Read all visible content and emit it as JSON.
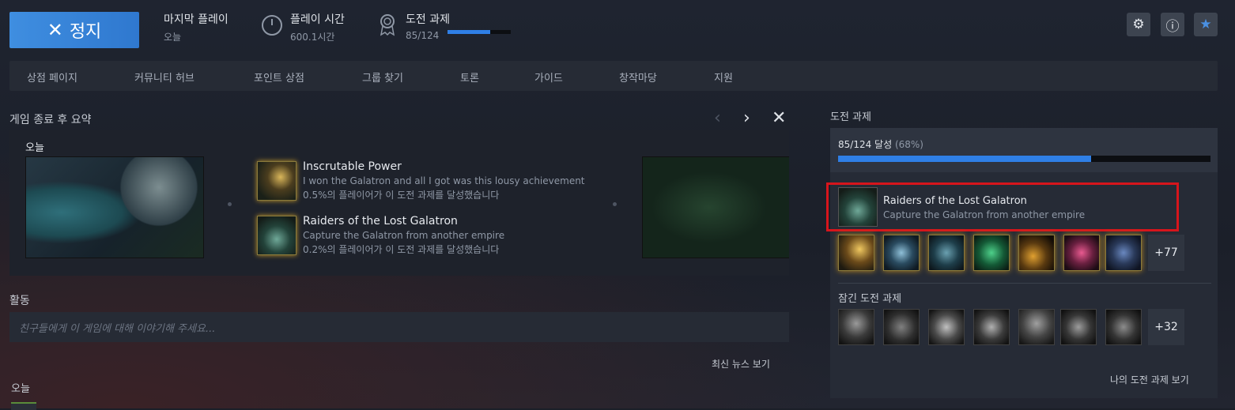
{
  "header": {
    "stop_label": "정지",
    "last_played_label": "마지막 플레이",
    "last_played_value": "오늘",
    "playtime_label": "플레이 시간",
    "playtime_value": "600.1시간",
    "achievements_label": "도전 과제",
    "achievements_value": "85/124",
    "achievements_progress": 0.68
  },
  "nav": [
    "상점 페이지",
    "커뮤니티 허브",
    "포인트 상점",
    "그룹 찾기",
    "토론",
    "가이드",
    "창작마당",
    "지원"
  ],
  "summary": {
    "title": "게임 종료 후 요약",
    "today": "오늘",
    "achievements": [
      {
        "title": "Inscrutable Power",
        "desc": "I won the Galatron and all I got was this lousy achievement",
        "pct": "0.5%의 플레이어가 이 도전 과제를 달성했습니다"
      },
      {
        "title": "Raiders of the Lost Galatron",
        "desc": "Capture the Galatron from another empire",
        "pct": "0.2%의 플레이어가 이 도전 과제를 달성했습니다"
      }
    ]
  },
  "activity": {
    "title": "활동",
    "placeholder": "친구들에게 이 게임에 대해 이야기해 주세요...",
    "news_link": "최신 뉴스 보기",
    "today": "오늘"
  },
  "achievements_panel": {
    "title": "도전 과제",
    "progress_text": "85/124 달성",
    "progress_pct": "(68%)",
    "progress": 0.68,
    "latest": {
      "title": "Raiders of the Lost Galatron",
      "desc": "Capture the Galatron from another empire"
    },
    "unlocked_more": "+77",
    "locked_title": "잠긴 도전 과제",
    "locked_more": "+32",
    "view_link": "나의 도전 과제 보기"
  },
  "colors": {
    "accent": "#2f7fe6",
    "highlight": "#d7151c",
    "gold": "#c89b2a"
  }
}
